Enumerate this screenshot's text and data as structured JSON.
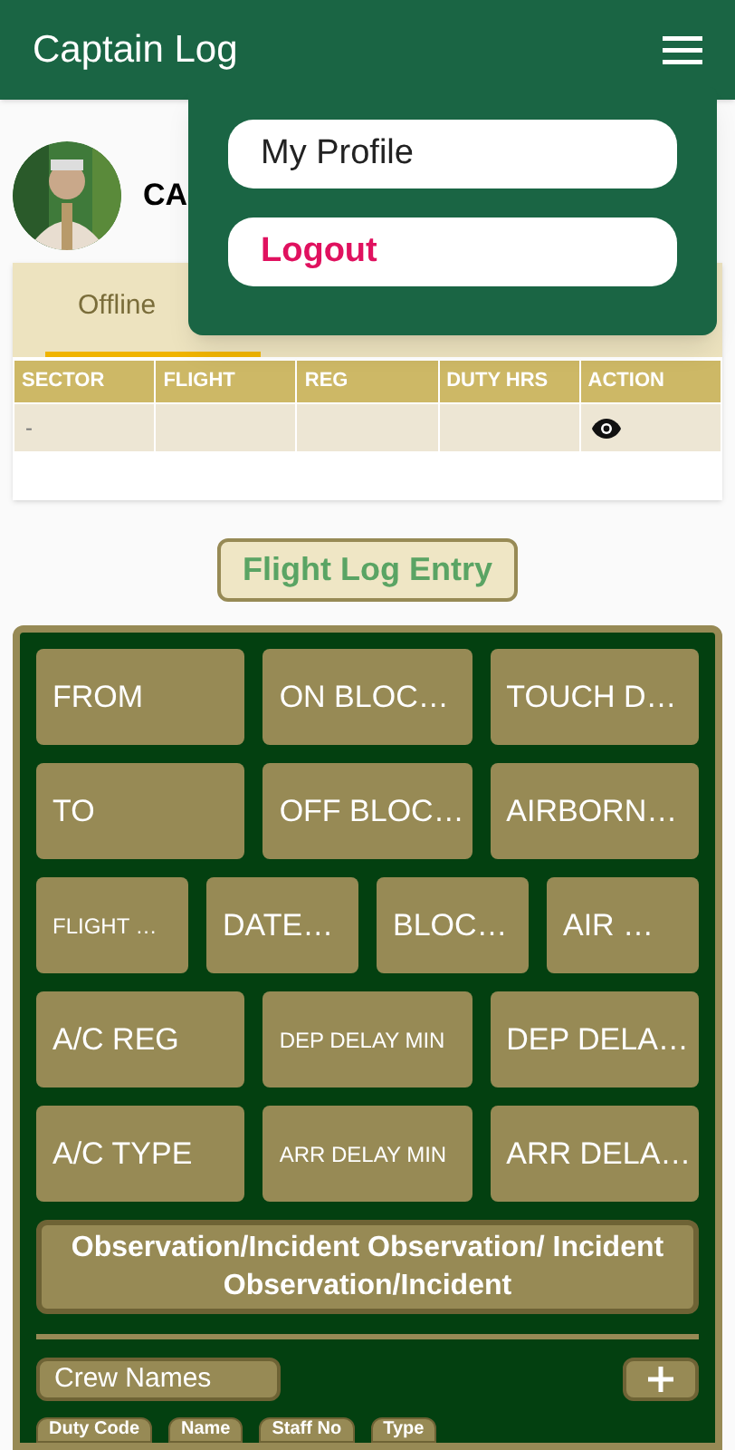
{
  "app_bar": {
    "title": "Captain Log"
  },
  "menu": {
    "items": [
      {
        "label": "My Profile",
        "kind": "normal"
      },
      {
        "label": "Logout",
        "kind": "danger"
      }
    ]
  },
  "profile": {
    "name": "CA"
  },
  "tabs": [
    {
      "label": "Offline",
      "selected": true
    }
  ],
  "table": {
    "columns": [
      "SECTOR",
      "FLIGHT",
      "REG",
      "DUTY HRS",
      "ACTION"
    ],
    "rows": [
      {
        "sector": "-"
      }
    ]
  },
  "entry_button": "Flight Log Entry",
  "form": {
    "rows": [
      [
        {
          "label": "FROM",
          "kind": "large"
        },
        {
          "label": "ON BLOC…",
          "kind": "large"
        },
        {
          "label": "TOUCH D…",
          "kind": "large"
        }
      ],
      [
        {
          "label": "TO",
          "kind": "large"
        },
        {
          "label": "OFF BLOC…",
          "kind": "large"
        },
        {
          "label": "AIRBORN…",
          "kind": "large"
        }
      ],
      [
        {
          "label": "FLIGHT …",
          "kind": "small"
        },
        {
          "label": "DATE…",
          "kind": "large"
        },
        {
          "label": "BLOC…",
          "kind": "large"
        },
        {
          "label": "AIR …",
          "kind": "large"
        }
      ],
      [
        {
          "label": "A/C REG",
          "kind": "large"
        },
        {
          "label": "DEP DELAY MIN",
          "kind": "small"
        },
        {
          "label": "DEP DELA…",
          "kind": "large"
        }
      ],
      [
        {
          "label": "A/C TYPE",
          "kind": "large"
        },
        {
          "label": "ARR DELAY MIN",
          "kind": "small"
        },
        {
          "label": "ARR DELA…",
          "kind": "large"
        }
      ]
    ],
    "observation": "Observation/Incident Observation/ Incident Observation/Incident",
    "crew_names": "Crew Names",
    "crew_columns": [
      "Duty Code",
      "Name",
      "Staff No",
      "Type"
    ]
  }
}
